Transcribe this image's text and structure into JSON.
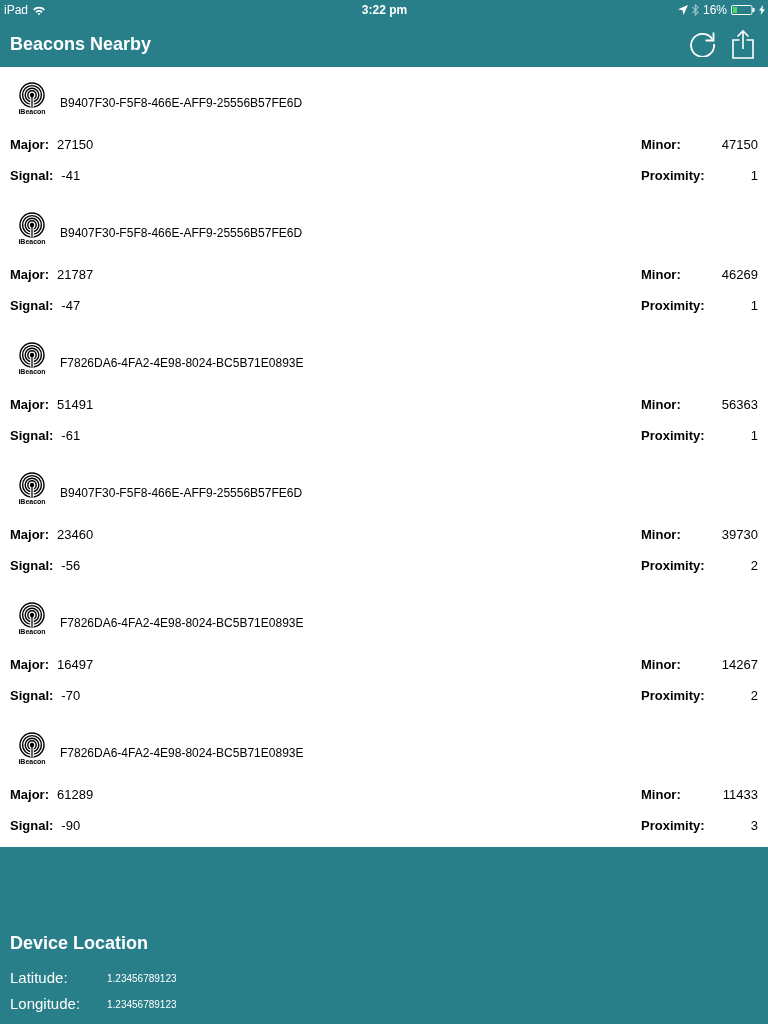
{
  "status_bar": {
    "carrier": "iPad",
    "time": "3:22 pm",
    "battery": "16%"
  },
  "nav_bar": {
    "title": "Beacons Nearby"
  },
  "beacons": [
    {
      "logo_text": "iBeacon",
      "uuid": "B9407F30-F5F8-466E-AFF9-25556B57FE6D",
      "major_label": "Major:",
      "major": "27150",
      "minor_label": "Minor:",
      "minor": "47150",
      "signal_label": "Signal:",
      "signal": "-41",
      "proximity_label": "Proximity:",
      "proximity": "1"
    },
    {
      "logo_text": "iBeacon",
      "uuid": "B9407F30-F5F8-466E-AFF9-25556B57FE6D",
      "major_label": "Major:",
      "major": "21787",
      "minor_label": "Minor:",
      "minor": "46269",
      "signal_label": "Signal:",
      "signal": "-47",
      "proximity_label": "Proximity:",
      "proximity": "1"
    },
    {
      "logo_text": "iBeacon",
      "uuid": "F7826DA6-4FA2-4E98-8024-BC5B71E0893E",
      "major_label": "Major:",
      "major": "51491",
      "minor_label": "Minor:",
      "minor": "56363",
      "signal_label": "Signal:",
      "signal": "-61",
      "proximity_label": "Proximity:",
      "proximity": "1"
    },
    {
      "logo_text": "iBeacon",
      "uuid": "B9407F30-F5F8-466E-AFF9-25556B57FE6D",
      "major_label": "Major:",
      "major": "23460",
      "minor_label": "Minor:",
      "minor": "39730",
      "signal_label": "Signal:",
      "signal": "-56",
      "proximity_label": "Proximity:",
      "proximity": "2"
    },
    {
      "logo_text": "iBeacon",
      "uuid": "F7826DA6-4FA2-4E98-8024-BC5B71E0893E",
      "major_label": "Major:",
      "major": "16497",
      "minor_label": "Minor:",
      "minor": "14267",
      "signal_label": "Signal:",
      "signal": "-70",
      "proximity_label": "Proximity:",
      "proximity": "2"
    },
    {
      "logo_text": "iBeacon",
      "uuid": "F7826DA6-4FA2-4E98-8024-BC5B71E0893E",
      "major_label": "Major:",
      "major": "61289",
      "minor_label": "Minor:",
      "minor": "11433",
      "signal_label": "Signal:",
      "signal": "-90",
      "proximity_label": "Proximity:",
      "proximity": "3"
    }
  ],
  "location": {
    "title": "Device Location",
    "rows": [
      {
        "label": "Latitude:",
        "value": "1.23456789123"
      },
      {
        "label": "Longitude:",
        "value": "1.23456789123"
      }
    ]
  }
}
